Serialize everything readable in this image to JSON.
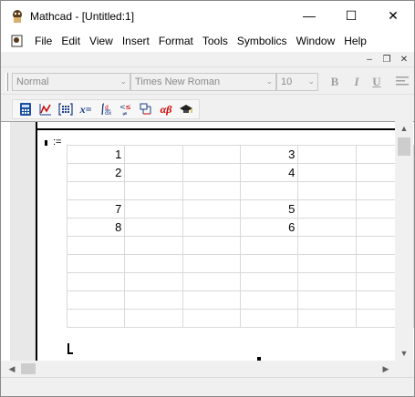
{
  "window": {
    "title": "Mathcad - [Untitled:1]",
    "minimize_glyph": "—",
    "maximize_glyph": "☐",
    "close_glyph": "✕"
  },
  "menu": {
    "items": [
      {
        "label": "File",
        "accel": "F"
      },
      {
        "label": "Edit",
        "accel": "E"
      },
      {
        "label": "View",
        "accel": "V"
      },
      {
        "label": "Insert",
        "accel": "I"
      },
      {
        "label": "Format",
        "accel": "o"
      },
      {
        "label": "Tools",
        "accel": "T"
      },
      {
        "label": "Symbolics",
        "accel": "S"
      },
      {
        "label": "Window",
        "accel": "W"
      },
      {
        "label": "Help",
        "accel": "H"
      }
    ]
  },
  "mdi_controls": {
    "minimize": "–",
    "restore": "❐",
    "close": "✕"
  },
  "format_toolbar": {
    "style_value": "Normal",
    "font_value": "Times New Roman",
    "size_value": "10",
    "bold": "B",
    "italic": "I",
    "underline": "U",
    "dropdown_arrow": "⌄"
  },
  "math_toolbar": {
    "icons": [
      "calculator-icon",
      "graph-icon",
      "matrix-icon",
      "evaluation-icon",
      "calculus-icon",
      "boolean-icon",
      "programming-icon",
      "greek-icon",
      "symbolic-icon"
    ],
    "evaluation_label": "x=",
    "greek_label": "αβ"
  },
  "document": {
    "assign_operator": ":=",
    "matrix_rows": [
      [
        "1",
        "",
        "",
        "3",
        "",
        ""
      ],
      [
        "2",
        "",
        "",
        "4",
        "",
        ""
      ],
      [
        "",
        "",
        "",
        "",
        "",
        ""
      ],
      [
        "7",
        "",
        "",
        "5",
        "",
        ""
      ],
      [
        "8",
        "",
        "",
        "6",
        "",
        ""
      ],
      [
        "",
        "",
        "",
        "",
        "",
        ""
      ],
      [
        "",
        "",
        "",
        "",
        "",
        ""
      ],
      [
        "",
        "",
        "",
        "",
        "",
        ""
      ],
      [
        "",
        "",
        "",
        "",
        "",
        ""
      ],
      [
        "",
        "",
        "",
        "",
        "",
        ""
      ]
    ]
  },
  "scrollbars": {
    "up": "▲",
    "down": "▼",
    "left": "◀",
    "right": "▶"
  }
}
